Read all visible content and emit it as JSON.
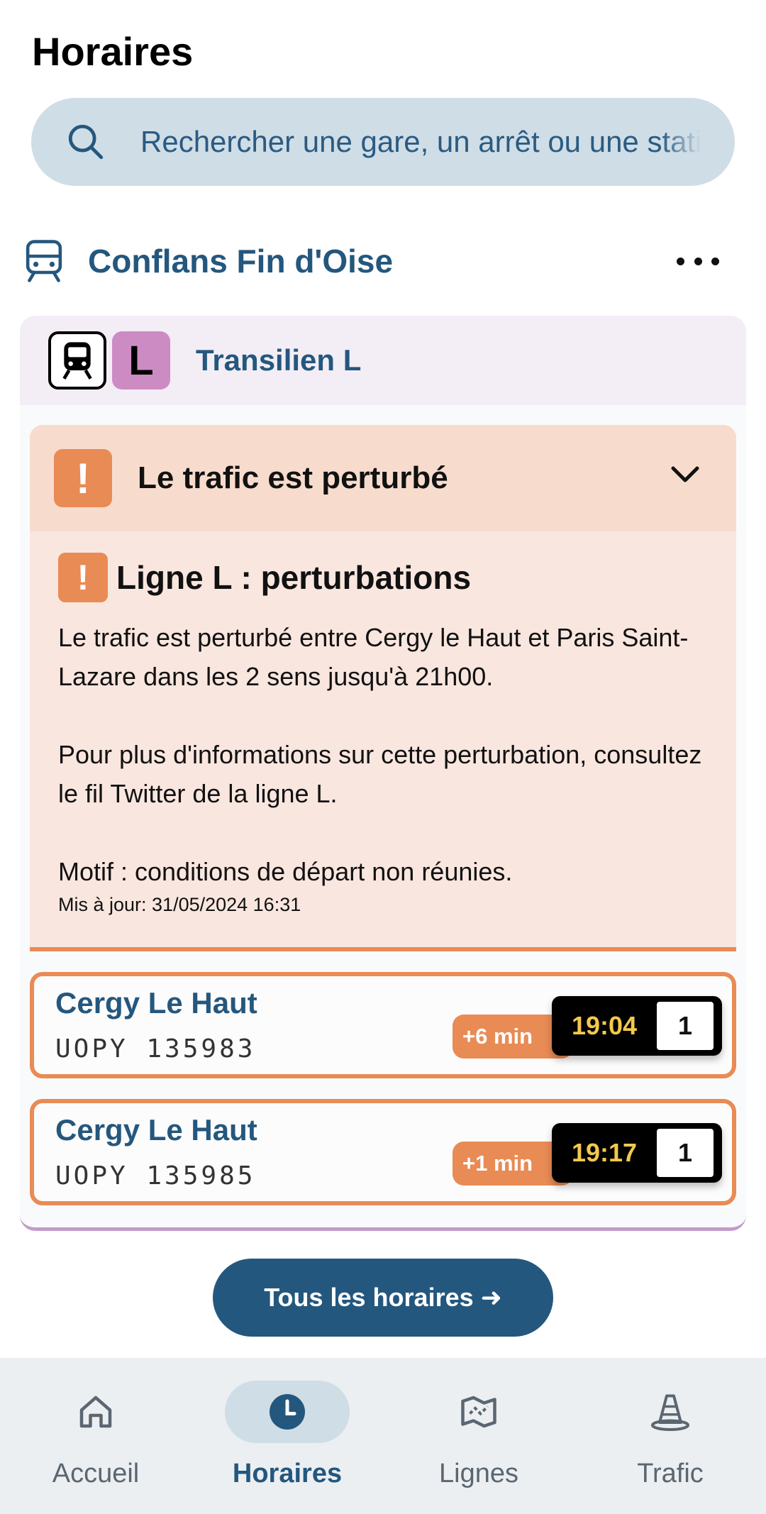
{
  "page": {
    "title": "Horaires"
  },
  "search": {
    "placeholder": "Rechercher une gare, un arrêt ou une station"
  },
  "stop": {
    "name": "Conflans Fin d'Oise"
  },
  "line": {
    "badge": "L",
    "name": "Transilien L",
    "color": "#cd8bc4"
  },
  "alert": {
    "title": "Le trafic est perturbé",
    "subtitle": "Ligne L : perturbations",
    "text": "Le trafic est perturbé entre Cergy le Haut et Paris Saint-Lazare dans les 2 sens jusqu'à 21h00.\n\nPour plus d'informations sur cette perturbation, consultez le fil Twitter de la ligne L.\n\nMotif : conditions de départ non réunies.",
    "updated": "Mis à jour: 31/05/2024 16:31",
    "warning_symbol": "!"
  },
  "departures": [
    {
      "destination": "Cergy Le Haut",
      "code": "UOPY 135983",
      "delay": "+6 min",
      "time": "19:04",
      "platform": "1"
    },
    {
      "destination": "Cergy Le Haut",
      "code": "UOPY 135985",
      "delay": "+1 min",
      "time": "19:17",
      "platform": "1"
    }
  ],
  "all_schedules_button": "Tous les horaires ➜",
  "nav": [
    {
      "label": "Accueil",
      "icon": "home-icon",
      "active": false
    },
    {
      "label": "Horaires",
      "icon": "clock-icon",
      "active": true
    },
    {
      "label": "Lignes",
      "icon": "map-icon",
      "active": false
    },
    {
      "label": "Trafic",
      "icon": "traffic-cone-icon",
      "active": false
    }
  ],
  "colors": {
    "accent": "#24577e",
    "warning": "#e98b55",
    "search_bg": "#cfdde6"
  }
}
